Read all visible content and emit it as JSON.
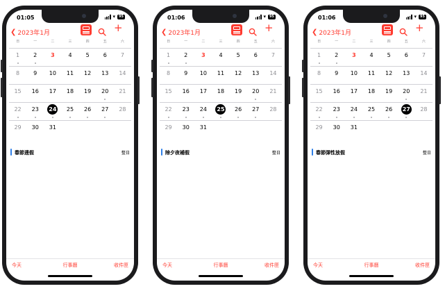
{
  "colors": {
    "accent": "#ff3b30",
    "event_bar": "#2f7fe6",
    "frame": "#1b1b1d"
  },
  "weekday_labels": [
    "日",
    "一",
    "二",
    "三",
    "四",
    "五",
    "六"
  ],
  "phones": [
    {
      "status": {
        "time": "01:05",
        "battery": "95"
      },
      "header": {
        "month": "2023年1月",
        "back_icon": "chevron-left-icon",
        "list_icon": "list-view-icon",
        "search_icon": "search-icon",
        "add_icon": "plus-icon"
      },
      "today_day": 3,
      "selected_day": 24,
      "weeks": [
        [
          {
            "d": 1,
            "dot": true
          },
          {
            "d": 2,
            "dot": true
          },
          {
            "d": 3,
            "dot": false
          },
          {
            "d": 4,
            "dot": false
          },
          {
            "d": 5,
            "dot": false
          },
          {
            "d": 6,
            "dot": false
          },
          {
            "d": 7,
            "dot": false
          }
        ],
        [
          {
            "d": 8,
            "dot": false
          },
          {
            "d": 9,
            "dot": false
          },
          {
            "d": 10,
            "dot": false
          },
          {
            "d": 11,
            "dot": false
          },
          {
            "d": 12,
            "dot": false
          },
          {
            "d": 13,
            "dot": false
          },
          {
            "d": 14,
            "dot": false
          }
        ],
        [
          {
            "d": 15,
            "dot": false
          },
          {
            "d": 16,
            "dot": false
          },
          {
            "d": 17,
            "dot": false
          },
          {
            "d": 18,
            "dot": false
          },
          {
            "d": 19,
            "dot": false
          },
          {
            "d": 20,
            "dot": true
          },
          {
            "d": 21,
            "dot": false
          }
        ],
        [
          {
            "d": 22,
            "dot": true
          },
          {
            "d": 23,
            "dot": true
          },
          {
            "d": 24,
            "dot": true
          },
          {
            "d": 25,
            "dot": true
          },
          {
            "d": 26,
            "dot": true
          },
          {
            "d": 27,
            "dot": true
          },
          {
            "d": 28,
            "dot": false
          }
        ],
        [
          {
            "d": 29,
            "dot": false
          },
          {
            "d": 30,
            "dot": false
          },
          {
            "d": 31,
            "dot": false
          }
        ]
      ],
      "event": {
        "title": "春節連假",
        "right": "整日"
      },
      "toolbar": {
        "left": "今天",
        "center": "行事曆",
        "right": "收件匣"
      }
    },
    {
      "status": {
        "time": "01:06",
        "battery": "95"
      },
      "header": {
        "month": "2023年1月",
        "back_icon": "chevron-left-icon",
        "list_icon": "list-view-icon",
        "search_icon": "search-icon",
        "add_icon": "plus-icon"
      },
      "today_day": 3,
      "selected_day": 25,
      "weeks": [
        [
          {
            "d": 1,
            "dot": true
          },
          {
            "d": 2,
            "dot": true
          },
          {
            "d": 3,
            "dot": false
          },
          {
            "d": 4,
            "dot": false
          },
          {
            "d": 5,
            "dot": false
          },
          {
            "d": 6,
            "dot": false
          },
          {
            "d": 7,
            "dot": false
          }
        ],
        [
          {
            "d": 8,
            "dot": false
          },
          {
            "d": 9,
            "dot": false
          },
          {
            "d": 10,
            "dot": false
          },
          {
            "d": 11,
            "dot": false
          },
          {
            "d": 12,
            "dot": false
          },
          {
            "d": 13,
            "dot": false
          },
          {
            "d": 14,
            "dot": false
          }
        ],
        [
          {
            "d": 15,
            "dot": false
          },
          {
            "d": 16,
            "dot": false
          },
          {
            "d": 17,
            "dot": false
          },
          {
            "d": 18,
            "dot": false
          },
          {
            "d": 19,
            "dot": false
          },
          {
            "d": 20,
            "dot": true
          },
          {
            "d": 21,
            "dot": false
          }
        ],
        [
          {
            "d": 22,
            "dot": true
          },
          {
            "d": 23,
            "dot": true
          },
          {
            "d": 24,
            "dot": true
          },
          {
            "d": 25,
            "dot": true
          },
          {
            "d": 26,
            "dot": true
          },
          {
            "d": 27,
            "dot": true
          },
          {
            "d": 28,
            "dot": false
          }
        ],
        [
          {
            "d": 29,
            "dot": false
          },
          {
            "d": 30,
            "dot": false
          },
          {
            "d": 31,
            "dot": false
          }
        ]
      ],
      "event": {
        "title": "除夕夜補假",
        "right": "整日"
      },
      "toolbar": {
        "left": "今天",
        "center": "行事曆",
        "right": "收件匣"
      }
    },
    {
      "status": {
        "time": "01:06",
        "battery": "95"
      },
      "header": {
        "month": "2023年1月",
        "back_icon": "chevron-left-icon",
        "list_icon": "list-view-icon",
        "search_icon": "search-icon",
        "add_icon": "plus-icon"
      },
      "today_day": 3,
      "selected_day": 27,
      "weeks": [
        [
          {
            "d": 1,
            "dot": true
          },
          {
            "d": 2,
            "dot": true
          },
          {
            "d": 3,
            "dot": false
          },
          {
            "d": 4,
            "dot": false
          },
          {
            "d": 5,
            "dot": false
          },
          {
            "d": 6,
            "dot": false
          },
          {
            "d": 7,
            "dot": false
          }
        ],
        [
          {
            "d": 8,
            "dot": false
          },
          {
            "d": 9,
            "dot": false
          },
          {
            "d": 10,
            "dot": false
          },
          {
            "d": 11,
            "dot": false
          },
          {
            "d": 12,
            "dot": false
          },
          {
            "d": 13,
            "dot": false
          },
          {
            "d": 14,
            "dot": false
          }
        ],
        [
          {
            "d": 15,
            "dot": false
          },
          {
            "d": 16,
            "dot": false
          },
          {
            "d": 17,
            "dot": false
          },
          {
            "d": 18,
            "dot": false
          },
          {
            "d": 19,
            "dot": false
          },
          {
            "d": 20,
            "dot": true
          },
          {
            "d": 21,
            "dot": false
          }
        ],
        [
          {
            "d": 22,
            "dot": true
          },
          {
            "d": 23,
            "dot": true
          },
          {
            "d": 24,
            "dot": true
          },
          {
            "d": 25,
            "dot": true
          },
          {
            "d": 26,
            "dot": true
          },
          {
            "d": 27,
            "dot": true
          },
          {
            "d": 28,
            "dot": false
          }
        ],
        [
          {
            "d": 29,
            "dot": false
          },
          {
            "d": 30,
            "dot": false
          },
          {
            "d": 31,
            "dot": false
          }
        ]
      ],
      "event": {
        "title": "春節彈性放假",
        "right": "整日"
      },
      "toolbar": {
        "left": "今天",
        "center": "行事曆",
        "right": "收件匣"
      }
    }
  ]
}
